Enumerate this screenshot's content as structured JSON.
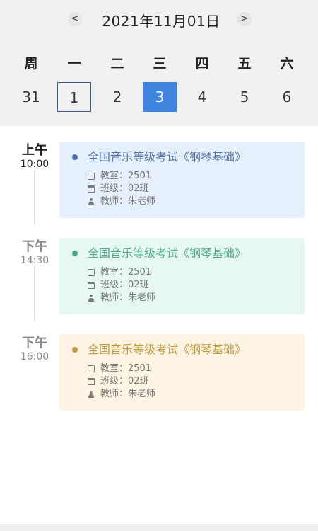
{
  "header": {
    "title": "2021年11月01日",
    "prev_icon": "<",
    "next_icon": ">"
  },
  "weekdays": [
    "周",
    "一",
    "二",
    "三",
    "四",
    "五",
    "六"
  ],
  "dates": [
    "31",
    "1",
    "2",
    "3",
    "4",
    "5",
    "6"
  ],
  "selected_date": "3",
  "today_date": "1",
  "events": [
    {
      "ampm": "上午",
      "time": "10:00",
      "title": "全国音乐等级考试《钢琴基础》",
      "classroom": "教室：2501",
      "grade": "班级：02班",
      "teacher": "教师：朱老师",
      "color": "#4f73a6",
      "bg": "#e6effc"
    },
    {
      "ampm": "下午",
      "time": "14:30",
      "title": "全国音乐等级考试《钢琴基础》",
      "classroom": "教室：2501",
      "grade": "班级：02班",
      "teacher": "教师：朱老师",
      "color": "#4ba88a",
      "bg": "#e6f8ef"
    },
    {
      "ampm": "下午",
      "time": "16:00",
      "title": "全国音乐等级考试《钢琴基础》",
      "classroom": "教室：2501",
      "grade": "班级：02班",
      "teacher": "教师：朱老师",
      "color": "#c0983e",
      "bg": "#fdf4e3"
    }
  ],
  "colors": {
    "accent": "#3f85e0",
    "header_bg": "#f1f1f1"
  }
}
